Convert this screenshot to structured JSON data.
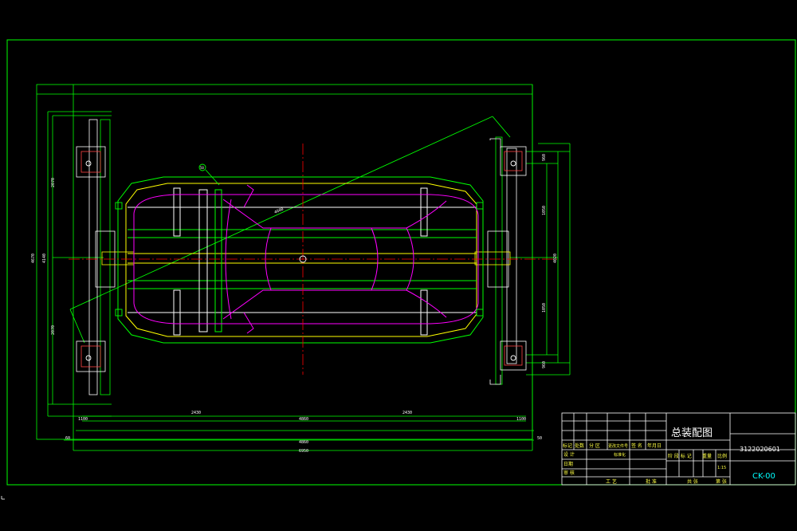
{
  "drawing": {
    "title": "总装配图",
    "drawing_number": "3122020601",
    "code": "CK-00",
    "scale": "1:15",
    "balloon": "50",
    "colors": {
      "background": "#000000",
      "frame": "#00ff00",
      "body": "#ff00ff",
      "centerline": "#ff0000",
      "outline": "#ffffff",
      "highlight": "#ffff00",
      "dimension": "#00ff00"
    }
  },
  "dimensions": {
    "bottom_total_1": "4860",
    "bottom_total_2": "6950",
    "bottom_mid": "4860",
    "bottom_left_half": "2430",
    "bottom_right_half": "2430",
    "left_small": "1100",
    "right_small": "1100",
    "left_top": "2070",
    "left_bottom": "2070",
    "left_total": "4140",
    "left_outer": "4670",
    "right_top": "960",
    "right_mid_1": "1050",
    "right_mid_2": "1050",
    "right_bottom": "960",
    "right_total": "4020",
    "diag": "4600",
    "small_left": "60",
    "small_right": "50"
  },
  "title_block": {
    "header_row": [
      "标记",
      "处数",
      "分 区",
      "更改文件号",
      "签 名",
      "年月日"
    ],
    "left_labels": [
      "设 计",
      "日期",
      "审 核"
    ],
    "standardization": "标准化",
    "stage_labels": [
      "阶 段 标 记",
      "重量",
      "比例"
    ],
    "bottom_labels": [
      "工 艺",
      "批 准",
      "共 张",
      "第 张"
    ]
  }
}
